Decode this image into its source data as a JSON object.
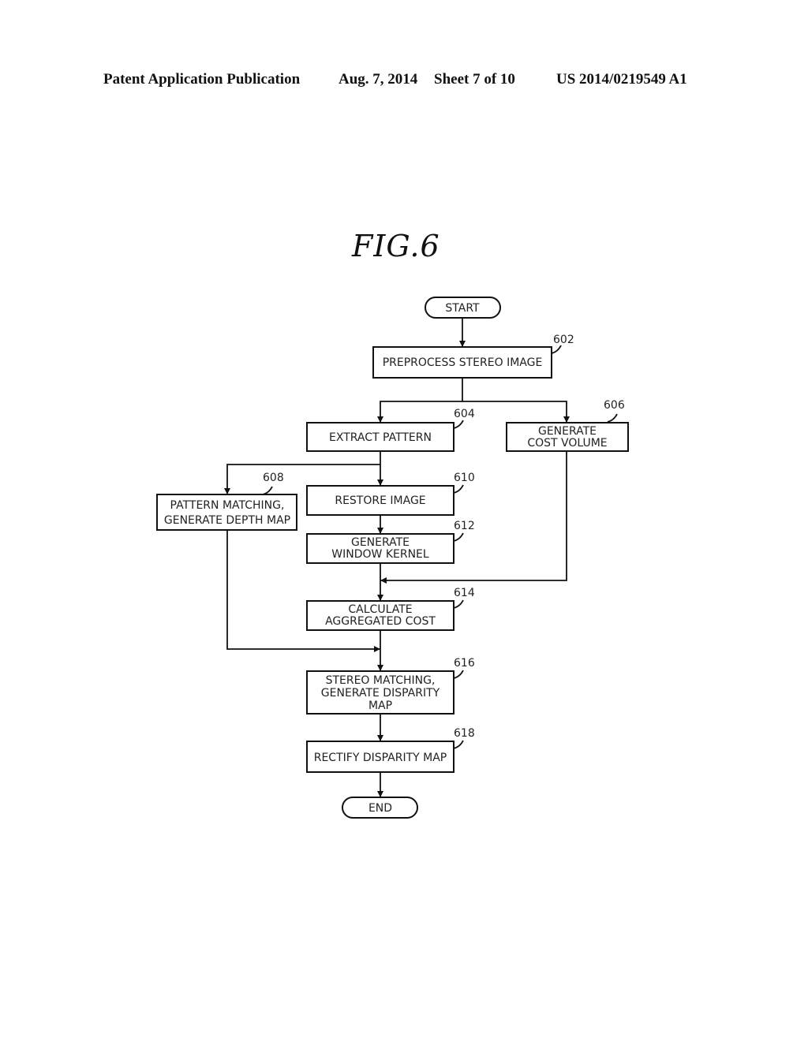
{
  "header": {
    "publication": "Patent Application Publication",
    "date": "Aug. 7, 2014",
    "sheet": "Sheet 7 of 10",
    "number": "US 2014/0219549 A1"
  },
  "figure": {
    "title": "FIG.6"
  },
  "flowchart": {
    "start": "START",
    "end": "END",
    "steps": {
      "s602": {
        "ref": "602",
        "lines": [
          "PREPROCESS STEREO IMAGE"
        ]
      },
      "s604": {
        "ref": "604",
        "lines": [
          "EXTRACT PATTERN"
        ]
      },
      "s606": {
        "ref": "606",
        "lines": [
          "GENERATE",
          "COST VOLUME"
        ]
      },
      "s608": {
        "ref": "608",
        "lines": [
          "PATTERN MATCHING,",
          "GENERATE DEPTH MAP"
        ]
      },
      "s610": {
        "ref": "610",
        "lines": [
          "RESTORE IMAGE"
        ]
      },
      "s612": {
        "ref": "612",
        "lines": [
          "GENERATE",
          "WINDOW KERNEL"
        ]
      },
      "s614": {
        "ref": "614",
        "lines": [
          "CALCULATE",
          "AGGREGATED COST"
        ]
      },
      "s616": {
        "ref": "616",
        "lines": [
          "STEREO MATCHING,",
          "GENERATE DISPARITY",
          "MAP"
        ]
      },
      "s618": {
        "ref": "618",
        "lines": [
          "RECTIFY DISPARITY MAP"
        ]
      }
    }
  }
}
